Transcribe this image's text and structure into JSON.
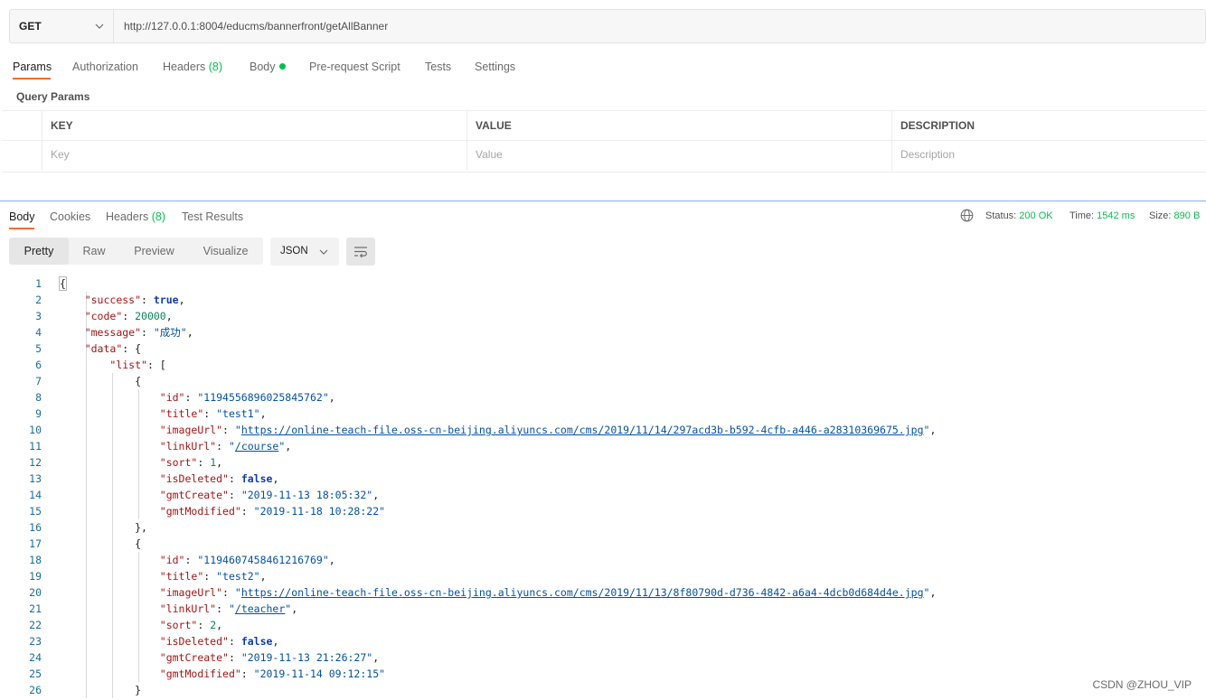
{
  "request": {
    "method": "GET",
    "url": "http://127.0.0.1:8004/educms/bannerfront/getAllBanner"
  },
  "request_tabs": {
    "params": "Params",
    "authorization": "Authorization",
    "headers": "Headers",
    "headers_count": "(8)",
    "body": "Body",
    "prerequest": "Pre-request Script",
    "tests": "Tests",
    "settings": "Settings"
  },
  "query_params": {
    "label": "Query Params",
    "columns": [
      "KEY",
      "VALUE",
      "DESCRIPTION"
    ],
    "placeholders": [
      "Key",
      "Value",
      "Description"
    ]
  },
  "response_tabs": {
    "body": "Body",
    "cookies": "Cookies",
    "headers": "Headers",
    "headers_count": "(8)",
    "test_results": "Test Results"
  },
  "status_bar": {
    "status_label": "Status:",
    "status_value": "200 OK",
    "time_label": "Time:",
    "time_value": "1542 ms",
    "size_label": "Size:",
    "size_value": "890 B"
  },
  "view": {
    "modes": [
      "Pretty",
      "Raw",
      "Preview",
      "Visualize"
    ],
    "active_mode": "Pretty",
    "format": "JSON"
  },
  "colors": {
    "accent": "#f26b3a",
    "status_green": "#0cbb52"
  },
  "code_lines": [
    "1",
    "2",
    "3",
    "4",
    "5",
    "6",
    "7",
    "8",
    "9",
    "10",
    "11",
    "12",
    "13",
    "14",
    "15",
    "16",
    "17",
    "18",
    "19",
    "20",
    "21",
    "22",
    "23",
    "24",
    "25",
    "26"
  ],
  "response_json": {
    "success": "true",
    "code": "20000",
    "message": "\"成功\"",
    "items": [
      {
        "id": "\"1194556896025845762\"",
        "title": "\"test1\"",
        "imageUrl": "https://online-teach-file.oss-cn-beijing.aliyuncs.com/cms/2019/11/14/297acd3b-b592-4cfb-a446-a28310369675.jpg",
        "linkUrl": "/course",
        "sort": "1",
        "isDeleted": "false",
        "gmtCreate": "\"2019-11-13 18:05:32\"",
        "gmtModified": "\"2019-11-18 10:28:22\""
      },
      {
        "id": "\"1194607458461216769\"",
        "title": "\"test2\"",
        "imageUrl": "https://online-teach-file.oss-cn-beijing.aliyuncs.com/cms/2019/11/13/8f80790d-d736-4842-a6a4-4dcb0d684d4e.jpg",
        "linkUrl": "/teacher",
        "sort": "2",
        "isDeleted": "false",
        "gmtCreate": "\"2019-11-13 21:26:27\"",
        "gmtModified": "\"2019-11-14 09:12:15\""
      }
    ]
  },
  "watermark": "CSDN @ZHOU_VIP"
}
